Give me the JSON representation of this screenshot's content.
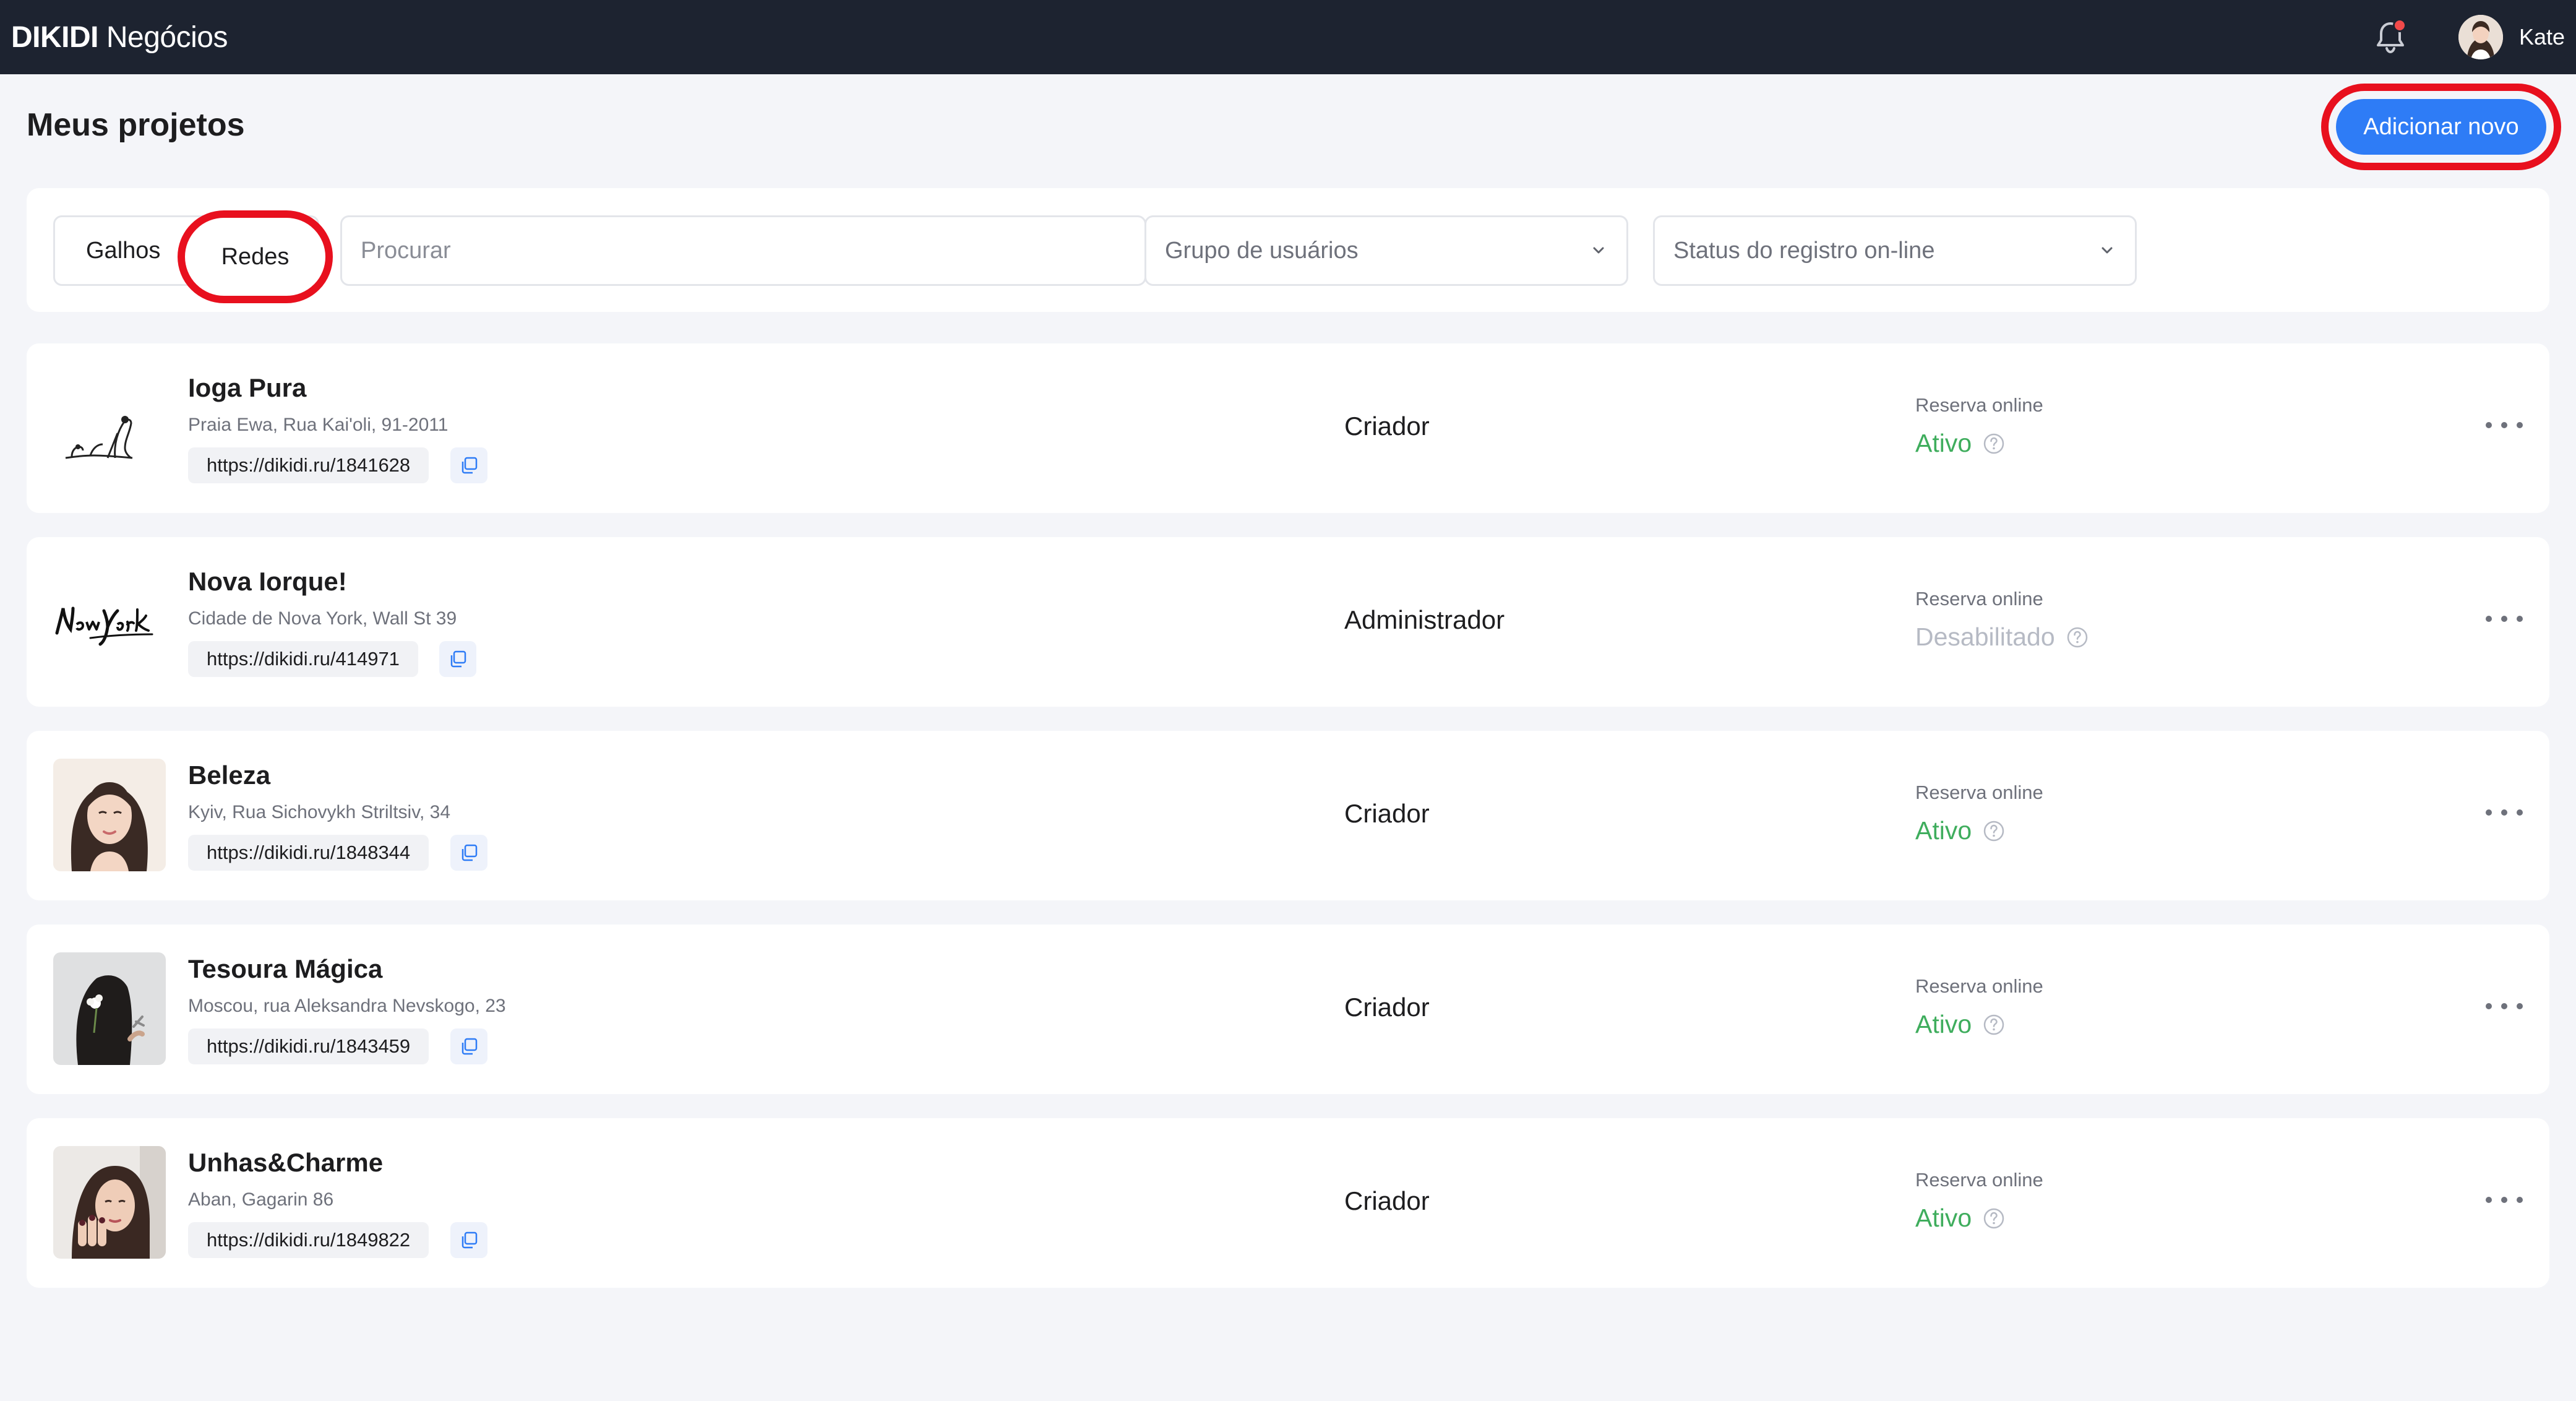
{
  "topbar": {
    "brand_bold": "DIKIDI",
    "brand_regular": "Negócios",
    "user_name": "Kate"
  },
  "page": {
    "title": "Meus projetos",
    "add_button": "Adicionar novo"
  },
  "filters": {
    "tab_branches": "Galhos",
    "tab_networks": "Redes",
    "search_placeholder": "Procurar",
    "user_group_placeholder": "Grupo de usuários",
    "online_status_placeholder": "Status do registro on-line"
  },
  "labels": {
    "online_booking": "Reserva online"
  },
  "colors": {
    "topbar": "#1d2330",
    "accent": "#2e7cf6",
    "active": "#3fad5d",
    "disabled": "#b6bac4",
    "highlight": "#e8101e"
  },
  "projects": [
    {
      "name": "Ioga Pura",
      "address": "Praia Ewa, Rua Kai'oli, 91-2011",
      "link": "https://dikidi.ru/1841628",
      "role": "Criador",
      "booking_status": "Ativo",
      "booking_active": true
    },
    {
      "name": "Nova Iorque!",
      "address": "Cidade de Nova York, Wall St 39",
      "link": "https://dikidi.ru/414971",
      "role": "Administrador",
      "booking_status": "Desabilitado",
      "booking_active": false
    },
    {
      "name": "Beleza",
      "address": "Kyiv, Rua Sichovykh Striltsiv, 34",
      "link": "https://dikidi.ru/1848344",
      "role": "Criador",
      "booking_status": "Ativo",
      "booking_active": true
    },
    {
      "name": "Tesoura Mágica",
      "address": "Moscou, rua Aleksandra Nevskogo, 23",
      "link": "https://dikidi.ru/1843459",
      "role": "Criador",
      "booking_status": "Ativo",
      "booking_active": true
    },
    {
      "name": "Unhas&Charme",
      "address": "Aban, Gagarin 86",
      "link": "https://dikidi.ru/1849822",
      "role": "Criador",
      "booking_status": "Ativo",
      "booking_active": true
    }
  ]
}
